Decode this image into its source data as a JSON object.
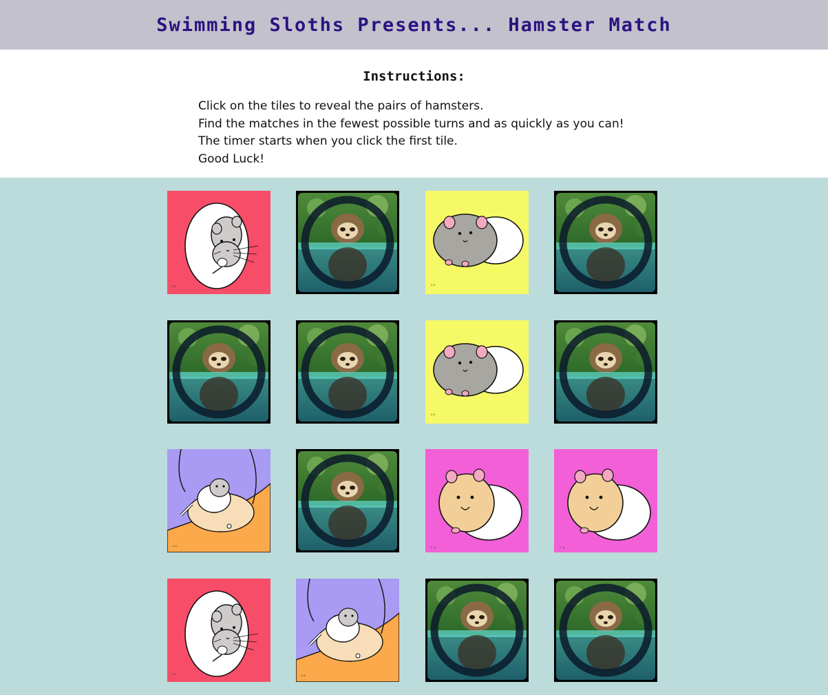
{
  "header": {
    "title": "Swimming Sloths Presents... Hamster Match"
  },
  "instructions": {
    "heading": "Instructions:",
    "lines": [
      "Click on the tiles to reveal the pairs of hamsters.",
      "Find the matches in the fewest possible turns and as quickly as you can!",
      "The timer starts when you click the first tile.",
      "Good Luck!"
    ]
  },
  "board": {
    "rows": 4,
    "cols": 4,
    "tiles": [
      {
        "state": "revealed",
        "card": "white-hamster-red",
        "signature": "c.s."
      },
      {
        "state": "hidden",
        "card": "sloth-back"
      },
      {
        "state": "revealed",
        "card": "grey-hamster-yellow",
        "signature": "c.s."
      },
      {
        "state": "hidden",
        "card": "sloth-back"
      },
      {
        "state": "hidden",
        "card": "sloth-back"
      },
      {
        "state": "hidden",
        "card": "sloth-back"
      },
      {
        "state": "revealed",
        "card": "grey-hamster-yellow",
        "signature": "c.s."
      },
      {
        "state": "hidden",
        "card": "sloth-back"
      },
      {
        "state": "revealed",
        "card": "hand-hamster-purple",
        "signature": "c.s."
      },
      {
        "state": "hidden",
        "card": "sloth-back"
      },
      {
        "state": "revealed",
        "card": "tan-hamster-pink",
        "signature": "c. s."
      },
      {
        "state": "revealed",
        "card": "tan-hamster-pink",
        "signature": "c. s."
      },
      {
        "state": "revealed",
        "card": "white-hamster-red",
        "signature": "c.s."
      },
      {
        "state": "revealed",
        "card": "hand-hamster-purple",
        "signature": "c.s."
      },
      {
        "state": "hidden",
        "card": "sloth-back"
      },
      {
        "state": "hidden",
        "card": "sloth-back"
      }
    ]
  },
  "colors": {
    "header_bg": "#c3c1cc",
    "title": "#2a1380",
    "board_bg": "#bcdbdb",
    "red_card": "#f84d68",
    "yellow_card": "#f6f966",
    "purple_card": "#a99af3",
    "orange_card": "#fba94a",
    "pink_card": "#f25fd6"
  }
}
